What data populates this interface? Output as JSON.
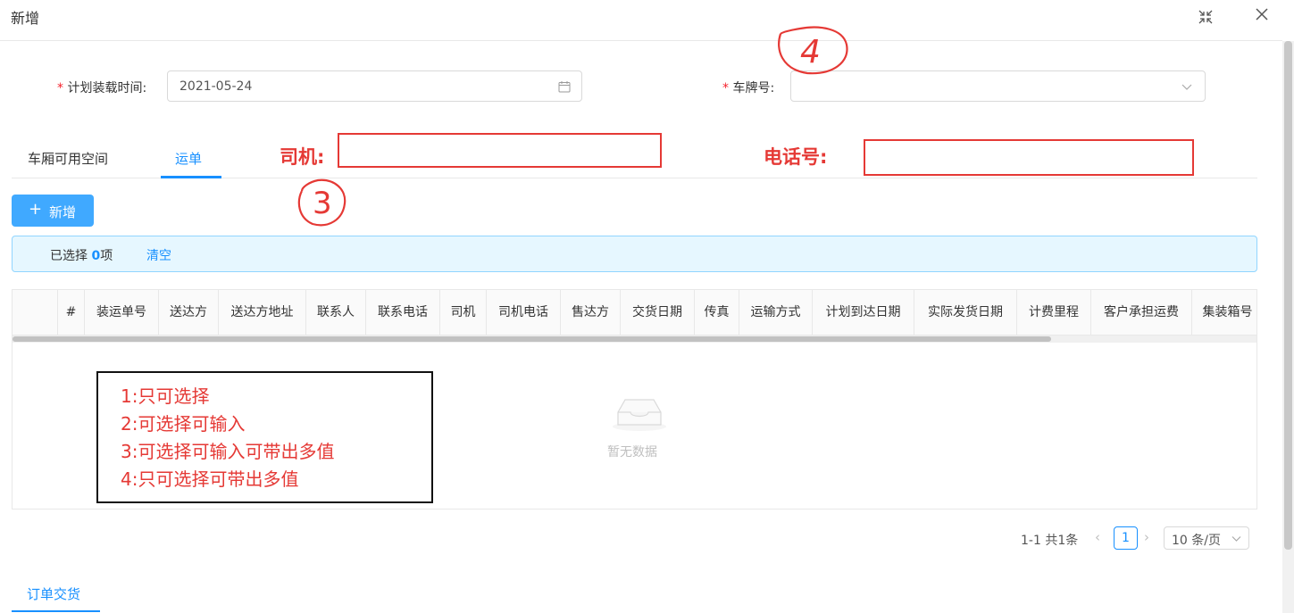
{
  "modal": {
    "title": "新增"
  },
  "form": {
    "load_time": {
      "label": "计划装载时间:",
      "value": "2021-05-24"
    },
    "plate": {
      "label": "车牌号:",
      "value": ""
    }
  },
  "tabs": [
    {
      "label": "车厢可用空间",
      "active": false
    },
    {
      "label": "运单",
      "active": true
    }
  ],
  "annotations": {
    "driver_label": "司机:",
    "phone_label": "电话号:",
    "mark_3": "3",
    "mark_4": "4"
  },
  "toolbar": {
    "add_label": "新增"
  },
  "selection": {
    "prefix": "已选择",
    "count": "0",
    "suffix": "项",
    "clear_label": "清空"
  },
  "table": {
    "columns": [
      "#",
      "装运单号",
      "送达方",
      "送达方地址",
      "联系人",
      "联系电话",
      "司机",
      "司机电话",
      "售达方",
      "交货日期",
      "传真",
      "运输方式",
      "计划到达日期",
      "实际发货日期",
      "计费里程",
      "客户承担运费",
      "集装箱号"
    ],
    "empty_text": "暂无数据"
  },
  "legend": {
    "lines": [
      "1:只可选择",
      "2:可选择可输入",
      "3:可选择可输入可带出多值",
      "4:只可选择可带出多值"
    ]
  },
  "pagination": {
    "total_text": "1-1 共1条",
    "current_page": "1",
    "page_size": "10 条/页"
  },
  "bottom_tabs": [
    {
      "label": "订单交货"
    }
  ],
  "colors": {
    "primary": "#1890ff",
    "danger": "#f5222d",
    "annotation_red": "#e53935"
  }
}
